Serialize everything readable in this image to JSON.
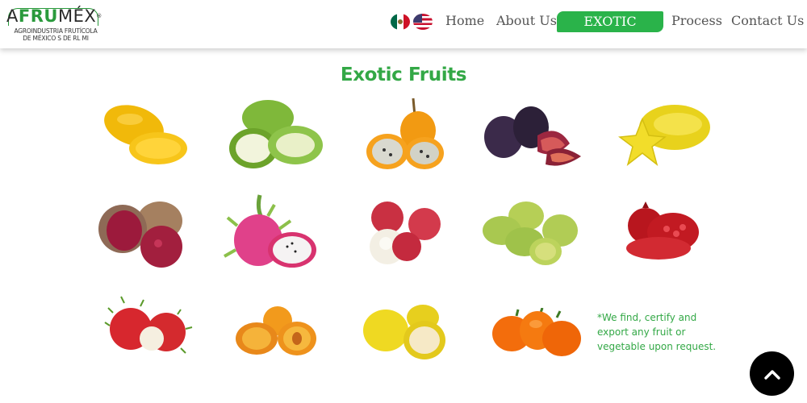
{
  "brand": {
    "logo_a": "A",
    "logo_fru": "FRU",
    "logo_mex": "MÉX",
    "logo_reg": "®",
    "logo_sub": "AGROINDUSTRIA FRUTÍCOLA DE MÉXICO S DE RL MI"
  },
  "languages": [
    {
      "name": "mexico-flag-icon",
      "colors": [
        "#006847",
        "#ffffff",
        "#ce1126"
      ]
    },
    {
      "name": "usa-flag-icon",
      "colors": [
        "#3c3b6e",
        "#c8102e",
        "#ffffff"
      ]
    }
  ],
  "nav": {
    "home": "Home",
    "about": "About Us",
    "exotic": "EXOTIC FRUITS",
    "process": "Process",
    "contact": "Contact Us",
    "active": "exotic"
  },
  "page": {
    "title": "Exotic Fruits",
    "note": "*We find, certify and export any fruit or vegetable upon request."
  },
  "fruits": [
    "mango",
    "green-mango",
    "passion-fruit",
    "fig",
    "starfruit",
    "mamey",
    "dragon-fruit",
    "lychee",
    "prickly-pear",
    "pomegranate",
    "rambutan",
    "apricot",
    "guava",
    "habanero"
  ],
  "colors": {
    "accent": "#2ab34a",
    "title": "#33a846",
    "nav_text": "#555555"
  },
  "scroll_top": {
    "icon": "chevron-up-icon"
  }
}
